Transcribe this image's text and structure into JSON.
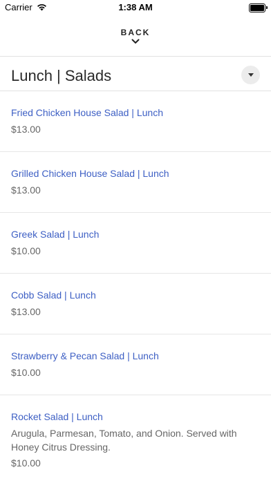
{
  "status": {
    "carrier": "Carrier",
    "time": "1:38 AM"
  },
  "nav": {
    "back_label": "BACK"
  },
  "section": {
    "title": "Lunch | Salads"
  },
  "items": [
    {
      "name": "Fried Chicken House Salad | Lunch",
      "price": "$13.00"
    },
    {
      "name": "Grilled Chicken House Salad | Lunch",
      "price": "$13.00"
    },
    {
      "name": "Greek Salad | Lunch",
      "price": "$10.00"
    },
    {
      "name": "Cobb Salad | Lunch",
      "price": "$13.00"
    },
    {
      "name": "Strawberry & Pecan Salad | Lunch",
      "price": "$10.00"
    },
    {
      "name": "Rocket Salad | Lunch",
      "desc": "Arugula, Parmesan, Tomato, and Onion. Served with Honey Citrus Dressing.",
      "price": "$10.00"
    }
  ],
  "colors": {
    "link": "#3d5fc4",
    "muted_text": "#666666",
    "divider": "#e2e2e2"
  }
}
